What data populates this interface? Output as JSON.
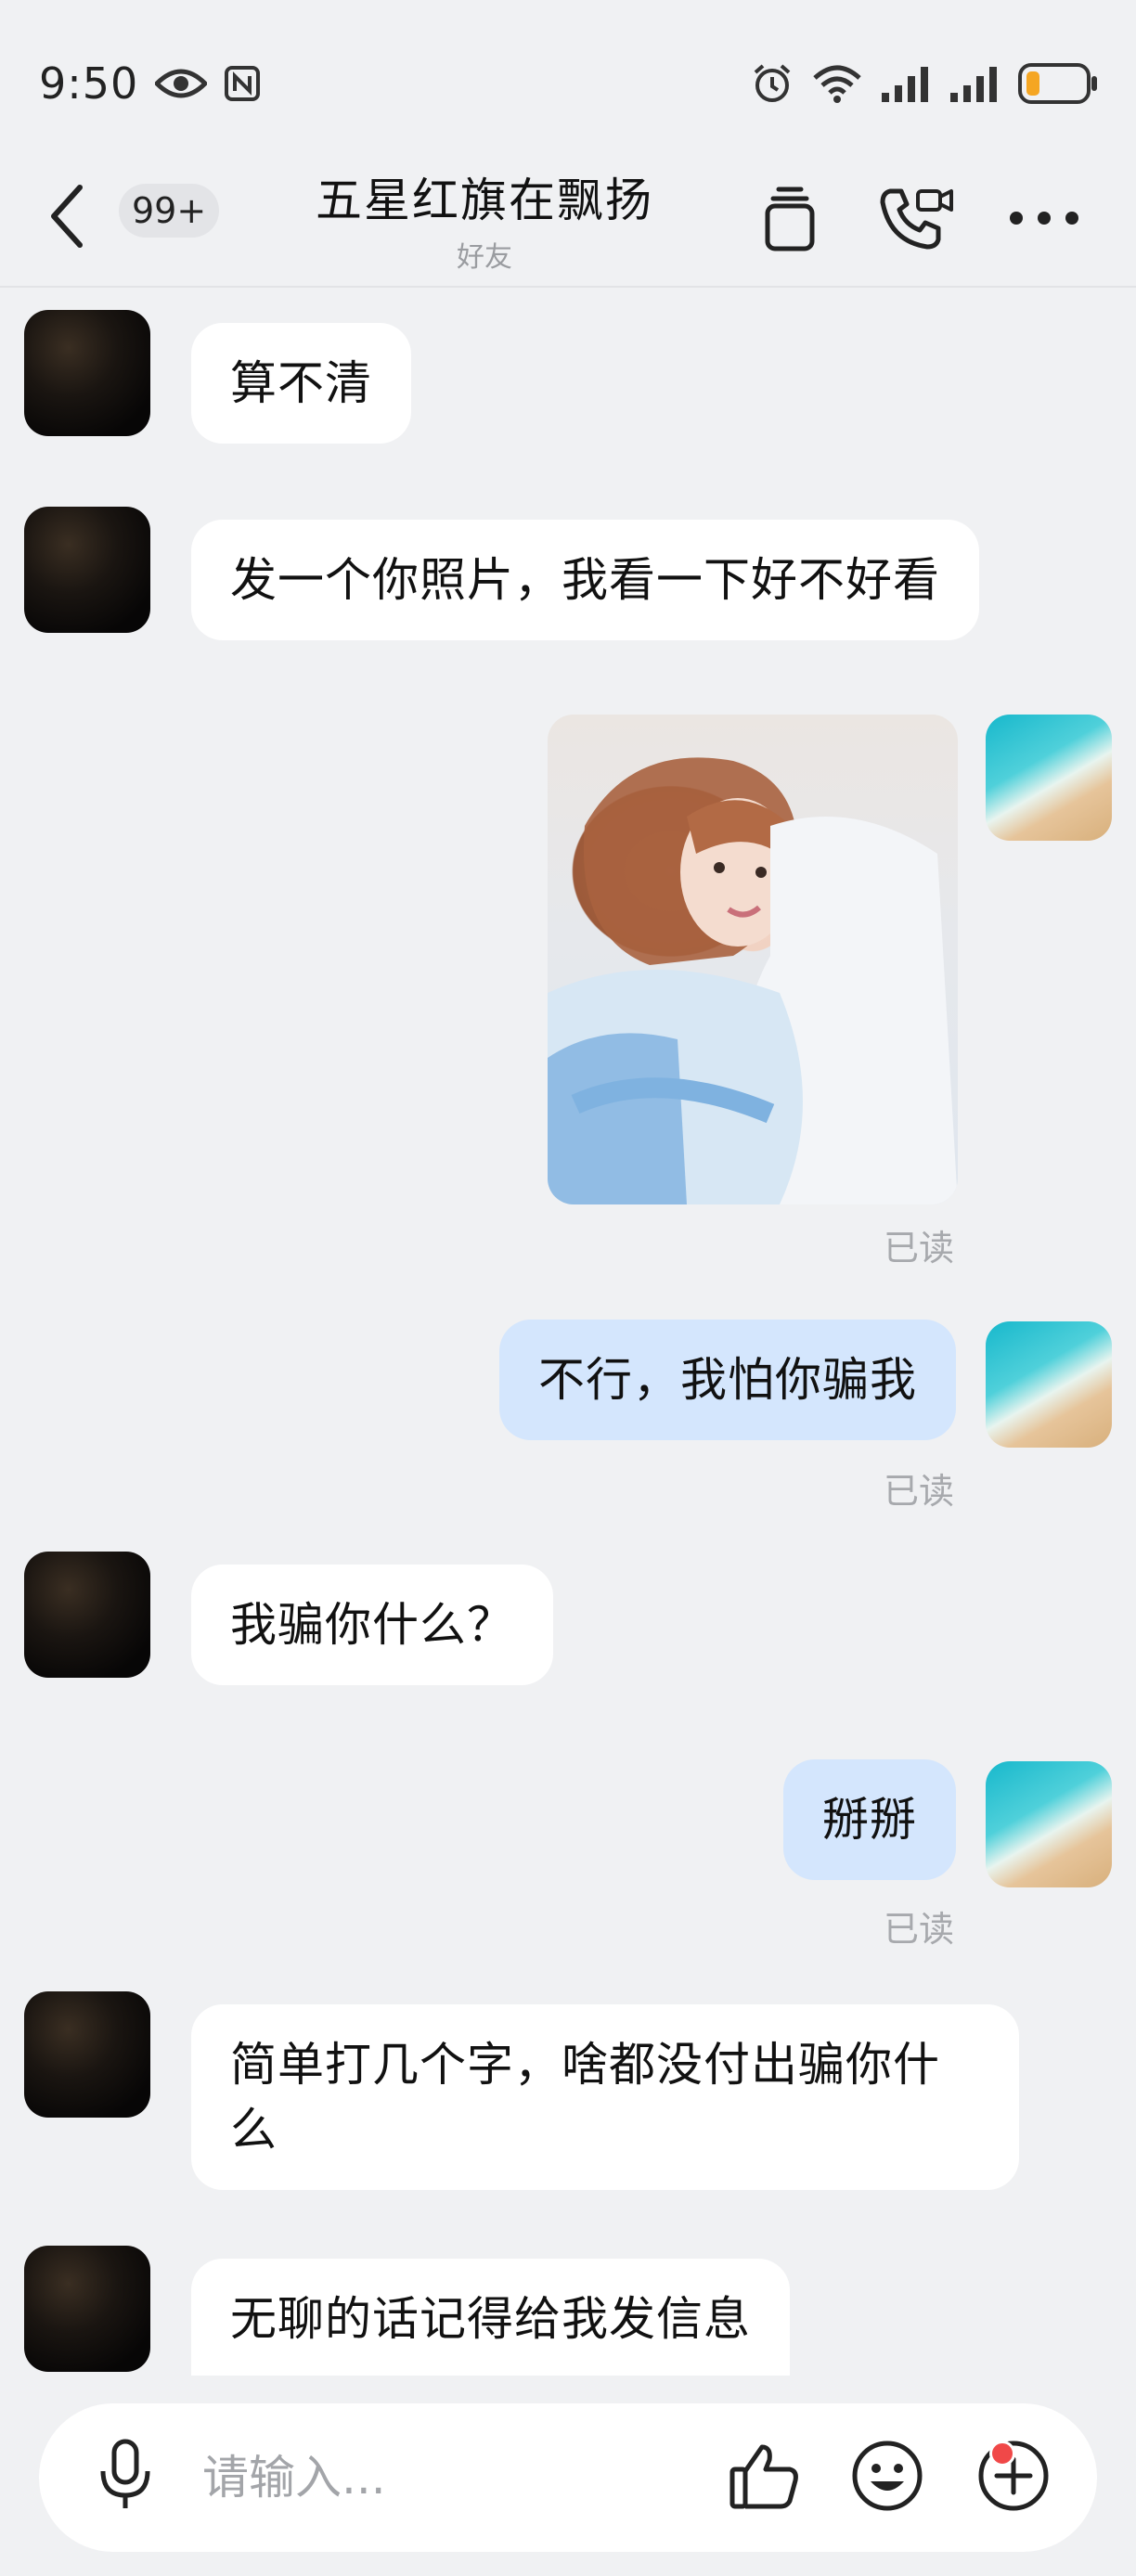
{
  "status_bar": {
    "time": "9:50"
  },
  "header": {
    "back_label": "返回",
    "unread_count": "99+",
    "title": "五星红旗在飘扬",
    "subtitle": "好友"
  },
  "messages": [
    {
      "direction": "in",
      "text": "算不清"
    },
    {
      "direction": "in",
      "text": "发一个你照片，我看一下好不好看"
    },
    {
      "direction": "out",
      "type": "image",
      "read": "已读"
    },
    {
      "direction": "out",
      "text": "不行，我怕你骗我",
      "read": "已读"
    },
    {
      "direction": "in",
      "text": "我骗你什么？"
    },
    {
      "direction": "out",
      "text": "掰掰",
      "read": "已读"
    },
    {
      "direction": "in",
      "text_line1": "简单打几个字，啥都没付出骗你什",
      "text_line2": "么"
    },
    {
      "direction": "in",
      "text": "无聊的话记得给我发信息"
    }
  ],
  "input": {
    "placeholder": "请输入..."
  },
  "colors": {
    "background": "#f0f1f3",
    "incoming_bubble": "#ffffff",
    "outgoing_bubble": "#d4e6fd",
    "read_text": "#a7a9ad",
    "notification_dot": "#f04848",
    "battery_fill": "#f5a623"
  },
  "icons": [
    "eye-icon",
    "nfc-icon",
    "alarm-icon",
    "wifi-icon",
    "signal-icon",
    "battery-icon",
    "back-chevron-icon",
    "copy-stack-icon",
    "video-call-icon",
    "more-icon",
    "microphone-icon",
    "thumbs-up-icon",
    "emoji-icon",
    "plus-icon"
  ]
}
